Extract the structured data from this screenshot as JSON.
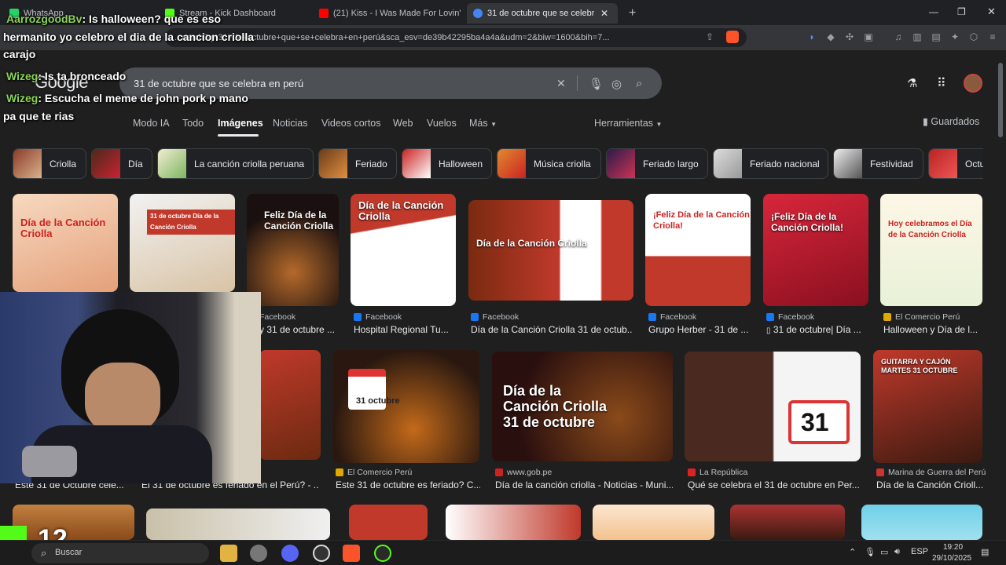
{
  "browser": {
    "tabs": [
      {
        "label": "WhatsApp",
        "color": "#25d366"
      },
      {
        "label": "Stream - Kick Dashboard",
        "color": "#53fc18"
      },
      {
        "label": "(21) Kiss - I Was Made For Lovin' You",
        "color": "#ff0000"
      },
      {
        "label": "31 de octubre que se celebra en",
        "color": "#4285f4"
      }
    ],
    "new_tab": "+",
    "url": "...earch?q=31+de+octubre+que+se+celebra+en+perú&sca_esv=de39b42295ba4a4a&udm=2&biw=1600&bih=7..."
  },
  "google": {
    "logo": "Google",
    "query": "31 de octubre que se celebra en perú",
    "nav": [
      "Modo IA",
      "Todo",
      "Imágenes",
      "Noticias",
      "Videos cortos",
      "Web",
      "Vuelos",
      "Más"
    ],
    "tools": "Herramientas",
    "saved": "Guardados",
    "chips": [
      "Criolla",
      "Día",
      "La canción criolla peruana",
      "Feriado",
      "Halloween",
      "Música criolla",
      "Feriado largo",
      "Feriado nacional",
      "Festividad",
      "Octu"
    ]
  },
  "results_row1": [
    {
      "title": "Día de la Canción Criolla",
      "source": "",
      "caption": ""
    },
    {
      "title": "31 de octubre Día de la Canción Criolla",
      "source": "",
      "caption": ""
    },
    {
      "title": "Feliz Día de la Canción Criolla",
      "source": "Facebook",
      "caption": "y 31 de octubre ..."
    },
    {
      "title": "Día de la Canción Criolla",
      "source": "Facebook",
      "caption": "Hospital Regional Tu..."
    },
    {
      "title": "Día de la Canción Criolla",
      "source": "Facebook",
      "caption": "Día de la Canción Criolla 31 de octub..."
    },
    {
      "title": "¡Feliz Día de la Canción Criolla!",
      "source": "Facebook",
      "caption": "Grupo Herber - 31 de ..."
    },
    {
      "title": "¡Feliz Día de la Canción Criolla!",
      "source": "Facebook",
      "caption": "31 de octubre| Día ..."
    },
    {
      "title": "Hoy celebramos el Día de la Canción Criolla",
      "source": "El Comercio Perú",
      "caption": "Halloween y Día de l..."
    }
  ],
  "results_row2": [
    {
      "title": "",
      "source": "",
      "caption": "Este 31 de Octubre cele..."
    },
    {
      "title": "",
      "source": "",
      "caption": "El 31 de octubre es feriado en el Perú? - ..."
    },
    {
      "title": "31 octubre",
      "source": "El Comercio Perú",
      "caption": "Este 31 de octubre es feriado? C..."
    },
    {
      "title": "Día de la Canción Criolla 31 de octubre",
      "source": "www.gob.pe",
      "caption": "Día de la canción criolla - Noticias - Muni..."
    },
    {
      "title": "31",
      "source": "La República",
      "caption": "Qué se celebra el 31 de octubre en Per..."
    },
    {
      "title": "GUITARRA Y CAJÓN  MARTES 31 OCTUBRE",
      "source": "Marina de Guerra del Perú",
      "caption": "Día de la Canción Crioll..."
    }
  ],
  "chat": [
    {
      "user": "AarrozgoodBv",
      "text": ": Is halloween? que es eso"
    },
    {
      "user": "",
      "text": "hermanito yo celebro el dia de la cancion criolla"
    },
    {
      "user": "",
      "text": "carajo"
    },
    {
      "user": "Wizeg",
      "text": ": Is ta bronceado"
    },
    {
      "user": "Wizeg",
      "text": ": Escucha el meme de john pork p mano"
    },
    {
      "user": "",
      "text": "pa que te rias"
    }
  ],
  "overlay": {
    "counter": "12"
  },
  "taskbar": {
    "search": "Buscar",
    "lang": "ESP",
    "time": "19:20",
    "date": "29/10/2025"
  }
}
